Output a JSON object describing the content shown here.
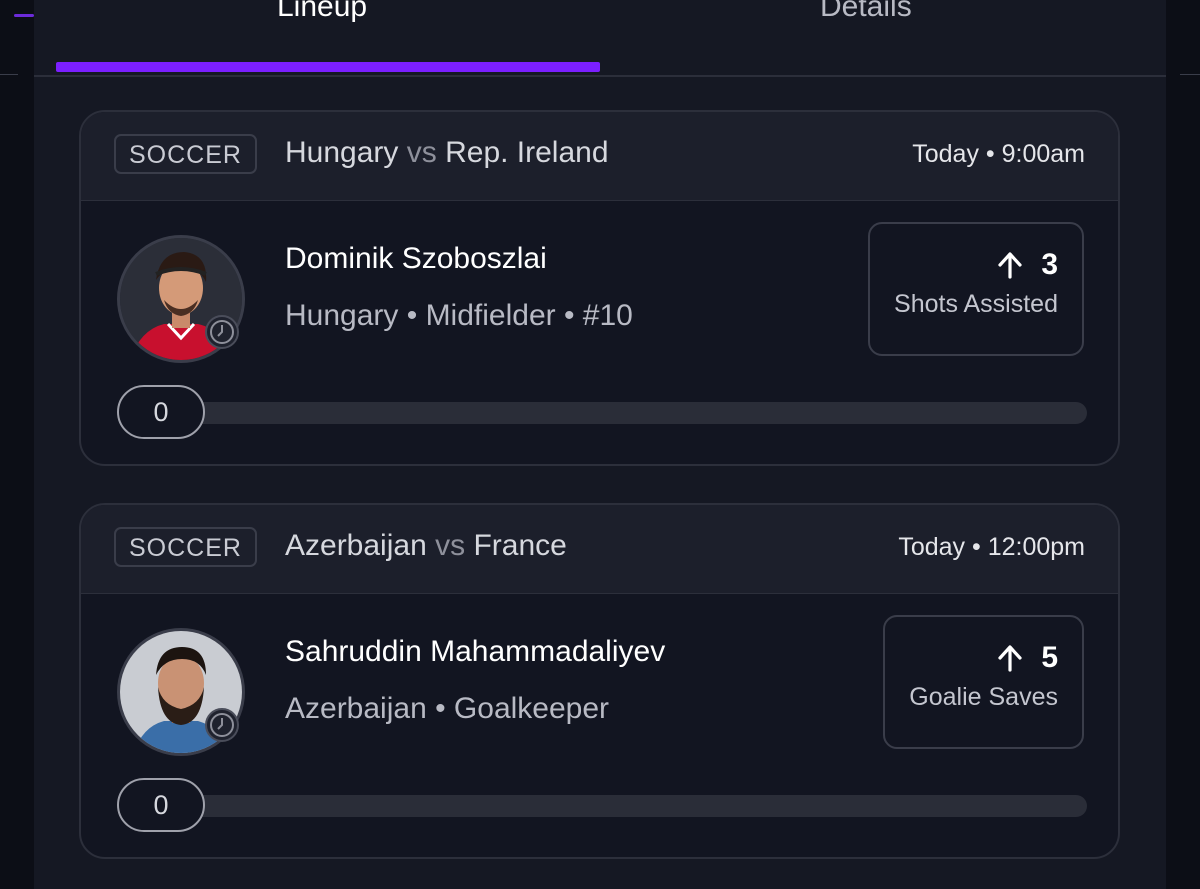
{
  "tabs": [
    {
      "label": "Lineup",
      "active": true
    },
    {
      "label": "Details",
      "active": false
    }
  ],
  "accent_color": "#7b1fff",
  "cards": [
    {
      "sport": "SOCCER",
      "team_home": "Hungary",
      "vs": "vs",
      "team_away": "Rep. Ireland",
      "time": "Today • 9:00am",
      "player_name": "Dominik Szoboszlai",
      "player_meta": "Hungary • Midfielder • #10",
      "stat_value": "3",
      "stat_direction": "up",
      "stat_label": "Shots Assisted",
      "progress_value": "0",
      "progress_fraction": 0
    },
    {
      "sport": "SOCCER",
      "team_home": "Azerbaijan",
      "vs": "vs",
      "team_away": "France",
      "time": "Today • 12:00pm",
      "player_name": "Sahruddin Mahammadaliyev",
      "player_meta": "Azerbaijan • Goalkeeper",
      "stat_value": "5",
      "stat_direction": "up",
      "stat_label": "Goalie Saves",
      "progress_value": "0",
      "progress_fraction": 0
    }
  ]
}
